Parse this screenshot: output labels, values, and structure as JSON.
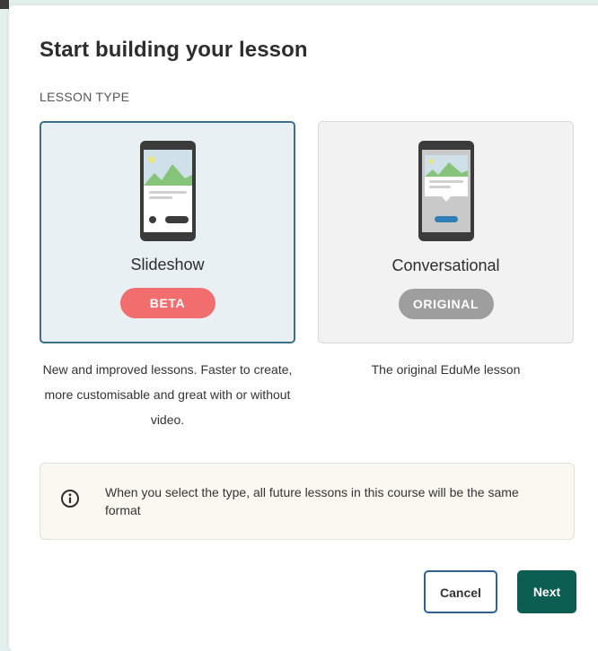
{
  "modal": {
    "title": "Start building your lesson",
    "section_label": "LESSON TYPE"
  },
  "lesson_types": [
    {
      "label": "Slideshow",
      "badge": "BETA",
      "badge_color": "#f26d6d",
      "selected": true,
      "description": "New and improved lessons. Faster to create, more customisable and great with or without video."
    },
    {
      "label": "Conversational",
      "badge": "ORIGINAL",
      "badge_color": "#9e9e9e",
      "selected": false,
      "description": "The original EduMe lesson"
    }
  ],
  "info": {
    "icon": "info-icon",
    "text": "When you select the type, all future lessons in this course will be the same format"
  },
  "buttons": {
    "cancel_label": "Cancel",
    "next_label": "Next"
  },
  "colors": {
    "selected_border": "#3d6f8a",
    "primary": "#0d5e52",
    "cancel_border": "#2c6390"
  }
}
